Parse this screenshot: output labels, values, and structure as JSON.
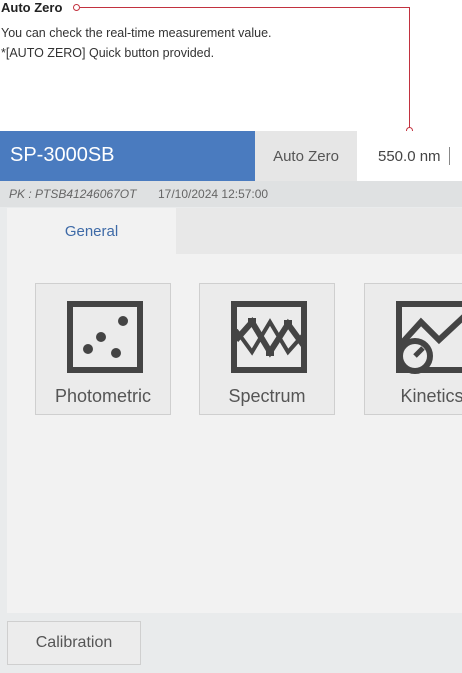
{
  "annotation": {
    "title": "Auto Zero",
    "line1": "You can check the real-time measurement value.",
    "line2": "*[AUTO ZERO] Quick button provided."
  },
  "app": {
    "title": "SP-3000SB",
    "auto_zero_label": "Auto Zero",
    "wavelength": "550.0 nm",
    "pk": "PK : PTSB41246067OT",
    "datetime": "17/10/2024 12:57:00",
    "tabs": [
      {
        "label": "General"
      }
    ],
    "modes": [
      {
        "label": "Photometric",
        "icon": "dice-icon"
      },
      {
        "label": "Spectrum",
        "icon": "spectrum-icon"
      },
      {
        "label": "Kinetics",
        "icon": "kinetics-icon"
      }
    ],
    "calibration_label": "Calibration"
  },
  "colors": {
    "accent": "#4a7bbf",
    "annotation_line": "#c2323f",
    "icon": "#444444"
  }
}
